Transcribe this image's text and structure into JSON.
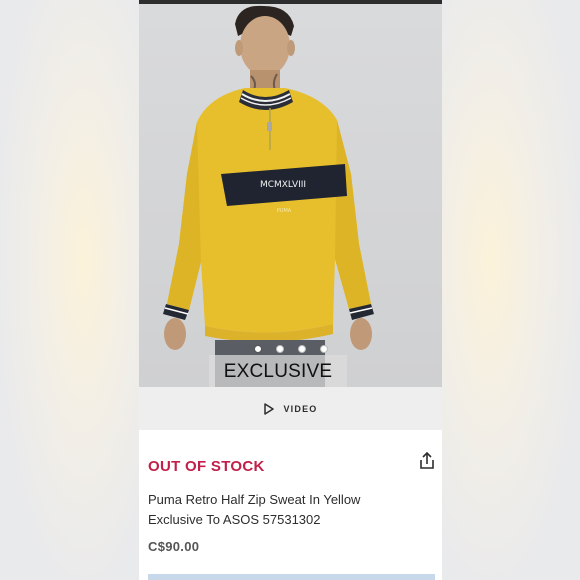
{
  "product": {
    "badge": "EXCLUSIVE",
    "print_text": "MCMXLVIII",
    "brand_mark": "PUMA",
    "video_label": "VIDEO",
    "stock_status": "OUT OF STOCK",
    "title": "Puma Retro Half Zip Sweat In Yellow Exclusive To ASOS 57531302",
    "price": "C$90.00",
    "image_count": 4,
    "active_image": 1
  },
  "icons": {
    "video": "play-icon",
    "share": "share-icon"
  },
  "colors": {
    "out_of_stock": "#c2204a",
    "sweater": "#e7bf2d",
    "video_bar": "#eeeeee"
  }
}
